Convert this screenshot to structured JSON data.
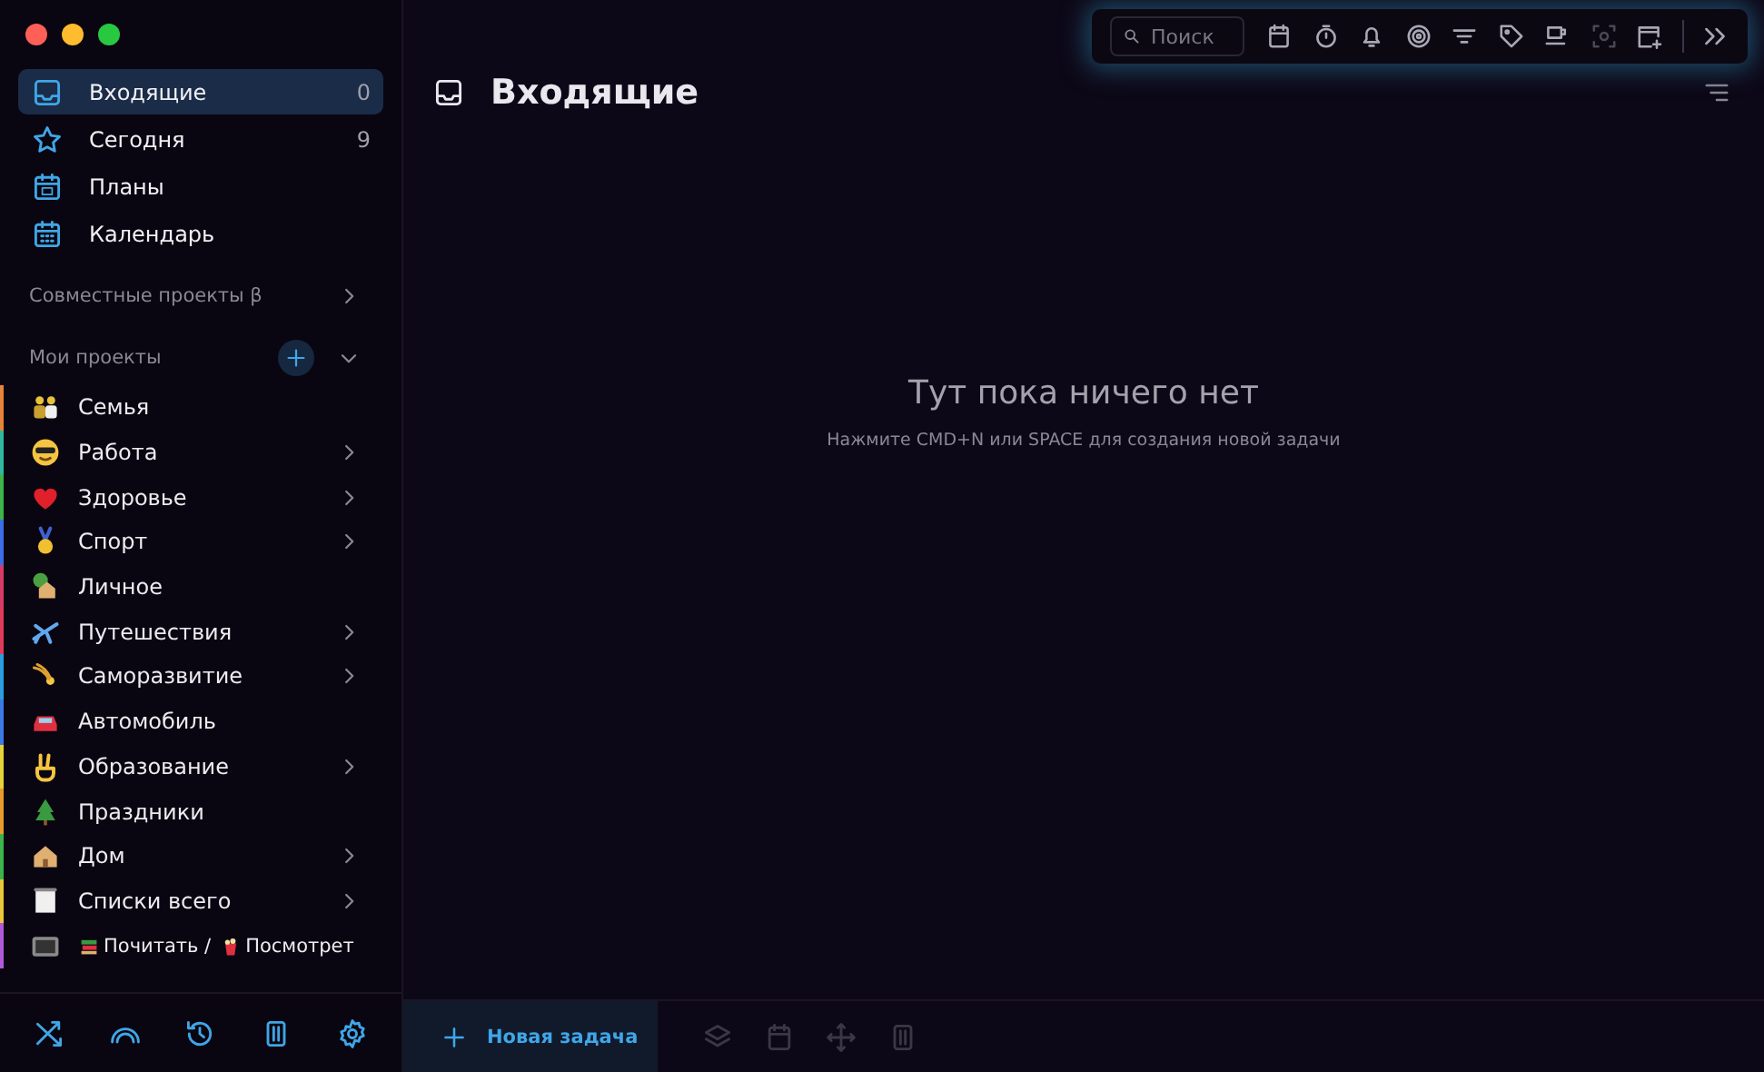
{
  "sidebar": {
    "nav": [
      {
        "label": "Входящие",
        "count": "0",
        "selected": true
      },
      {
        "label": "Сегодня",
        "count": "9",
        "selected": false
      },
      {
        "label": "Планы",
        "selected": false
      },
      {
        "label": "Календарь",
        "selected": false
      }
    ],
    "shared_section": {
      "label": "Совместные проекты β",
      "expanded": false
    },
    "projects_section": {
      "label": "Мои проекты",
      "expanded": true
    },
    "projects": [
      {
        "label": "Семья",
        "color": "#e8833a",
        "has_children": false
      },
      {
        "label": "Работа",
        "color": "#2fb8a0",
        "has_children": true
      },
      {
        "label": "Здоровье",
        "color": "#3cb44b",
        "has_children": true
      },
      {
        "label": "Спорт",
        "color": "#3a6ee8",
        "has_children": true
      },
      {
        "label": "Личное",
        "color": "#d83a6a",
        "has_children": false
      },
      {
        "label": "Путешествия",
        "color": "#e03a5a",
        "has_children": true
      },
      {
        "label": "Саморазвитие",
        "color": "#2a9de0",
        "has_children": true
      },
      {
        "label": "Автомобиль",
        "color": "#3a7ae8",
        "has_children": false
      },
      {
        "label": "Образование",
        "color": "#e8d23a",
        "has_children": true
      },
      {
        "label": "Праздники",
        "color": "#e89a2a",
        "has_children": false
      },
      {
        "label": "Дом",
        "color": "#3cb44b",
        "has_children": true
      },
      {
        "label": "Списки всего",
        "color": "#e8c83a",
        "has_children": true
      },
      {
        "label_parts": [
          "Почитать /",
          "Посмотрет"
        ],
        "color": "#b05ad8",
        "has_children": false
      }
    ]
  },
  "toolbar": {
    "search": {
      "placeholder": "Поиск"
    }
  },
  "main": {
    "title": "Входящие",
    "empty_title": "Тут пока ничего нет",
    "empty_hint": "Нажмите CMD+N или SPACE для создания новой задачи"
  },
  "bottom_bar": {
    "new_task": "Новая задача"
  }
}
